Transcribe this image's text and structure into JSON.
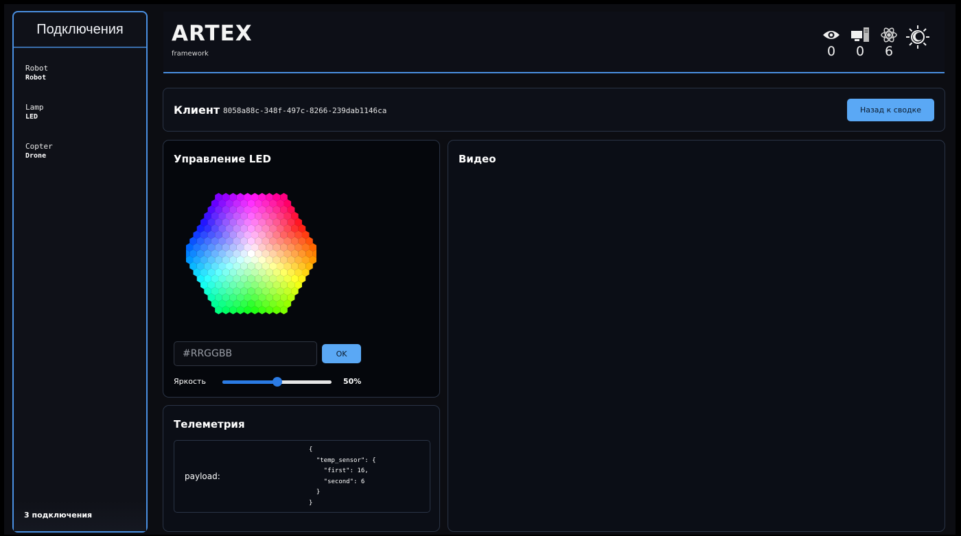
{
  "sidebar": {
    "title": "Подключения",
    "connections": [
      {
        "name": "Robot",
        "type": "Robot"
      },
      {
        "name": "Lamp",
        "type": "LED"
      },
      {
        "name": "Copter",
        "type": "Drone"
      }
    ],
    "footer": "3 подключения"
  },
  "header": {
    "logo": "ARTEX",
    "logo_sub": "framework",
    "stats": [
      {
        "icon": "eye-icon",
        "value": "0"
      },
      {
        "icon": "computer-icon",
        "value": "0"
      },
      {
        "icon": "atom-icon",
        "value": "6"
      }
    ],
    "theme_icon": "sun-moon-icon"
  },
  "client": {
    "label": "Клиент",
    "id": "8058a88c-348f-497c-8266-239dab1146ca",
    "back_button": "Назад к сводке"
  },
  "led": {
    "title": "Управление LED",
    "hex_placeholder": "#RRGGBB",
    "hex_prefix": "#",
    "ok_button": "OK",
    "brightness_label": "Яркость",
    "brightness_value": "50%",
    "brightness_fraction": 0.5
  },
  "video": {
    "title": "Видео"
  },
  "telemetry": {
    "title": "Телеметрия",
    "payload_label": "payload:",
    "payload_json": "{\n  \"temp_sensor\": {\n    \"first\": 16,\n    \"second\": 6\n  }\n}"
  },
  "colors": {
    "accent": "#4a90e2",
    "button": "#5aa8f5",
    "slider": "#2b7be4"
  }
}
